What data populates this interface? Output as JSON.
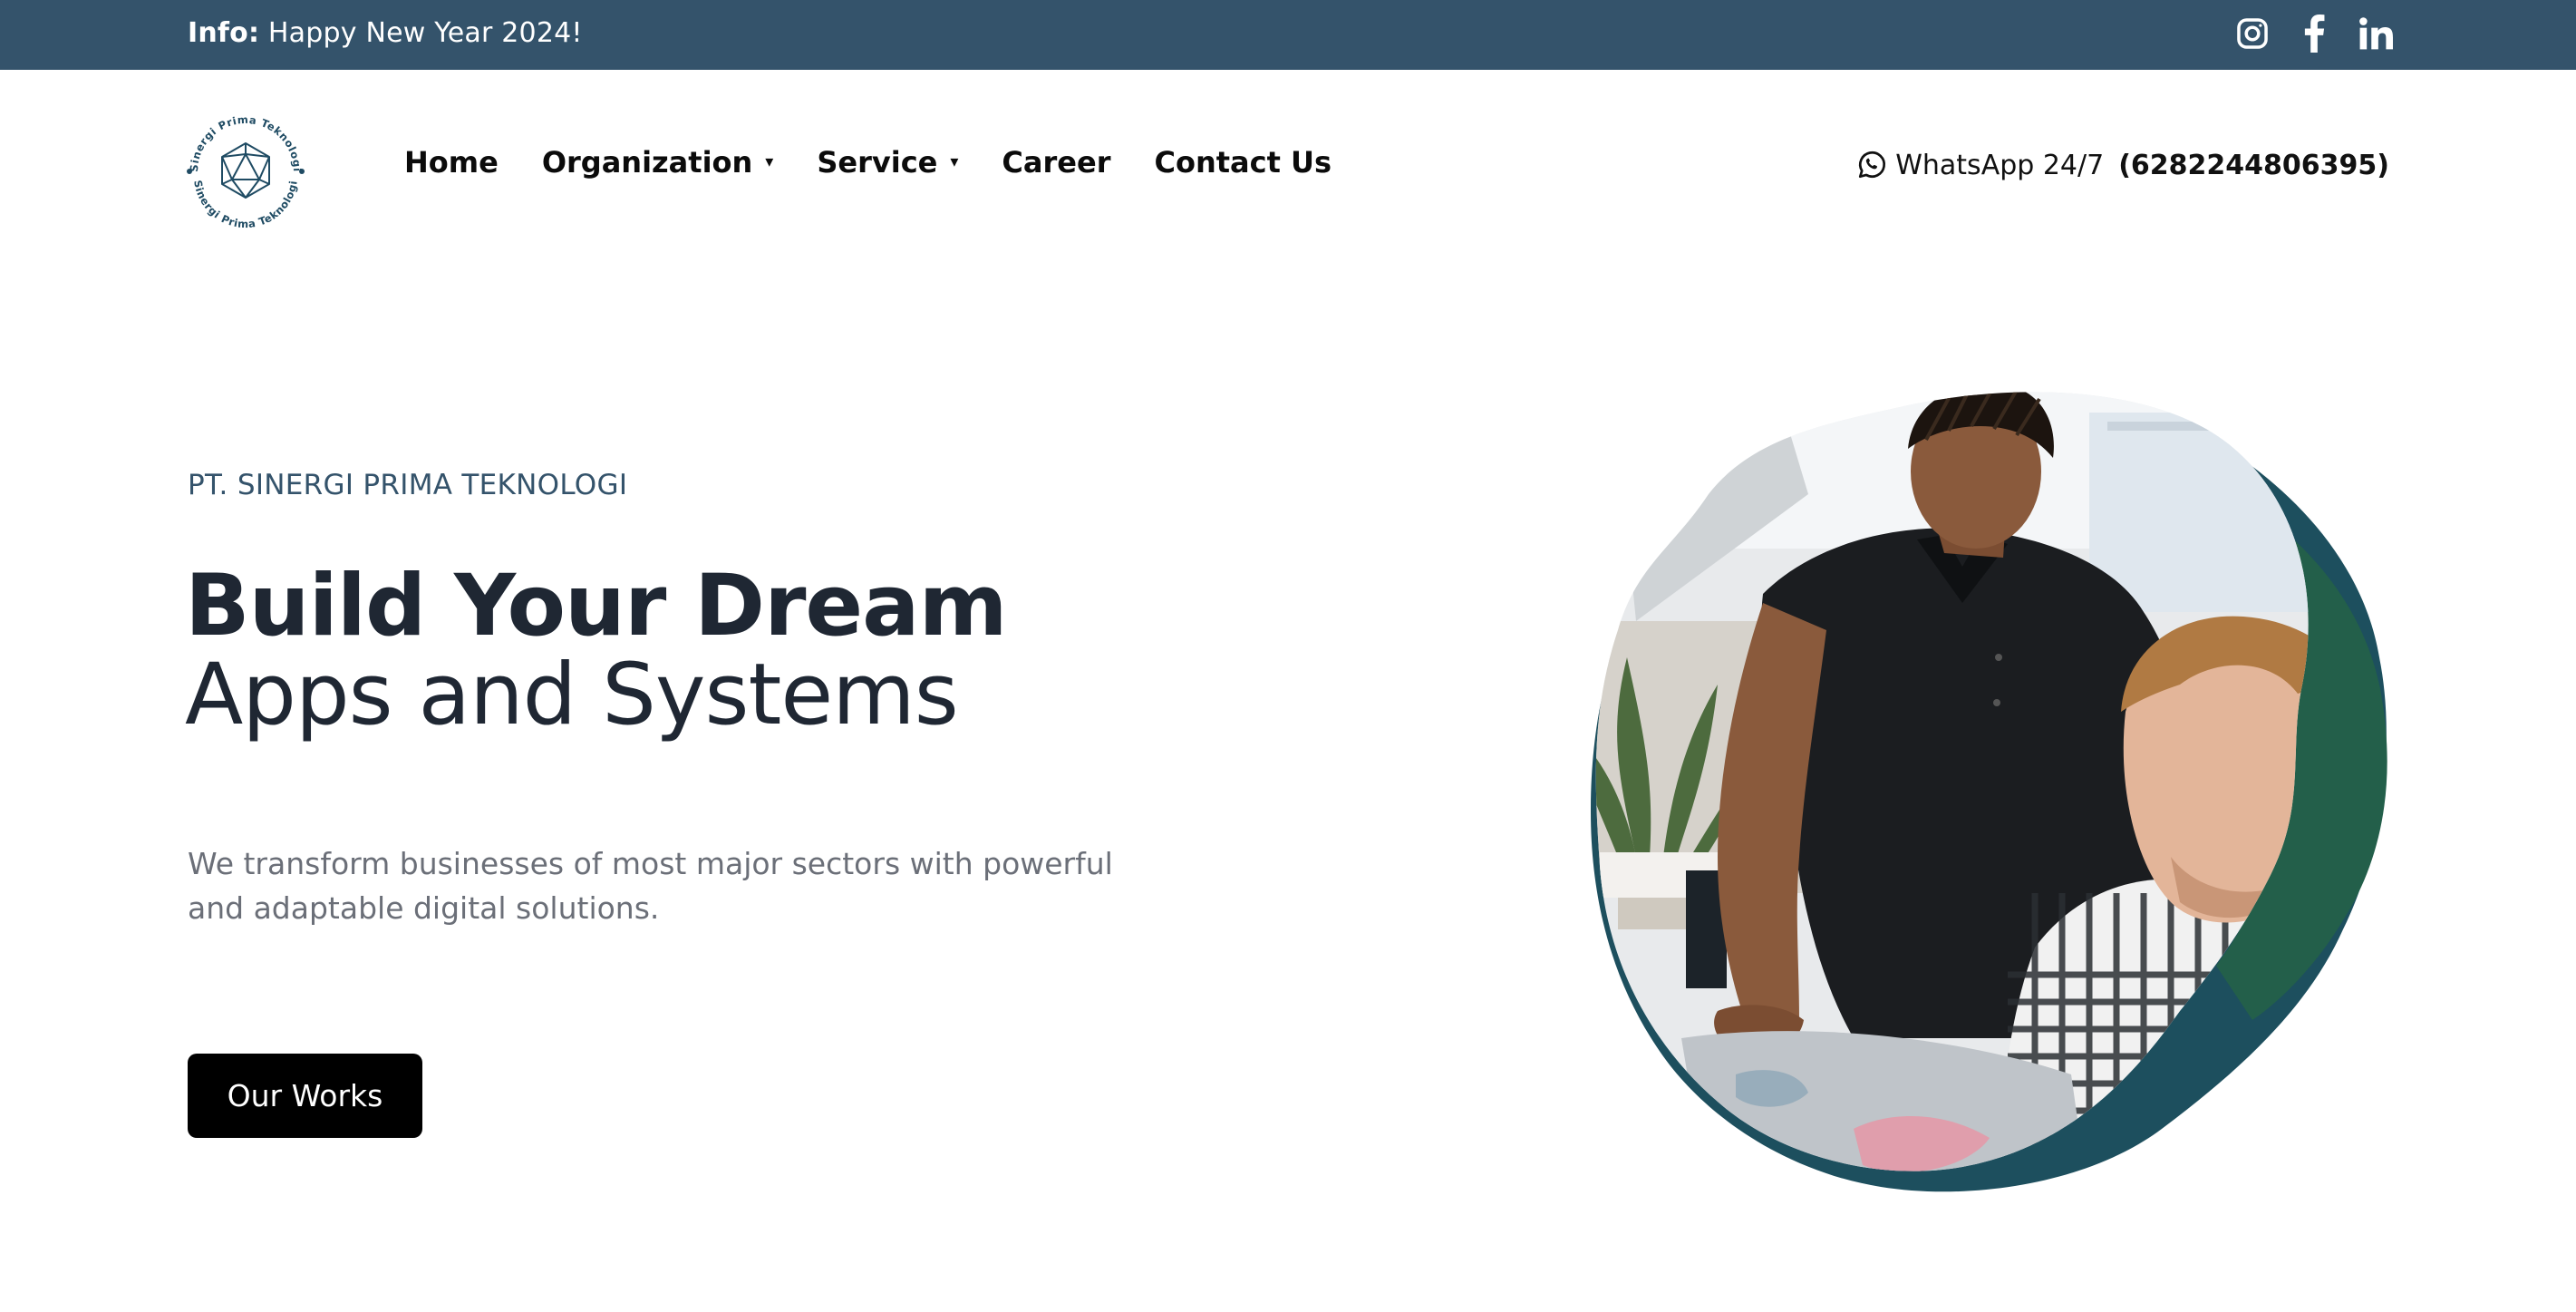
{
  "topbar": {
    "info_label": "Info:",
    "info_text": " Happy New Year 2024!",
    "socials": [
      "instagram-icon",
      "facebook-icon",
      "linkedin-icon"
    ]
  },
  "header": {
    "logo_text": "Sinergi Prima Teknologi",
    "nav": [
      {
        "label": "Home",
        "dropdown": false
      },
      {
        "label": "Organization",
        "dropdown": true
      },
      {
        "label": "Service",
        "dropdown": true
      },
      {
        "label": "Career",
        "dropdown": false
      },
      {
        "label": "Contact Us",
        "dropdown": false
      }
    ],
    "caret": "▾",
    "whatsapp_label": "WhatsApp 24/7",
    "whatsapp_number": "(6282244806395)"
  },
  "hero": {
    "eyebrow": "PT. SINERGI PRIMA TEKNOLOGI",
    "title_line1": "Build Your Dream",
    "title_line2": "Apps and Systems",
    "lead": "We transform businesses of most major sectors with powerful and adaptable digital solutions.",
    "cta_label": "Our Works"
  },
  "colors": {
    "topbar": "#34536b",
    "heading": "#1f2733",
    "button": "#000000",
    "blob_teal": "#1d4f5e",
    "blob_green": "#235f4a"
  }
}
